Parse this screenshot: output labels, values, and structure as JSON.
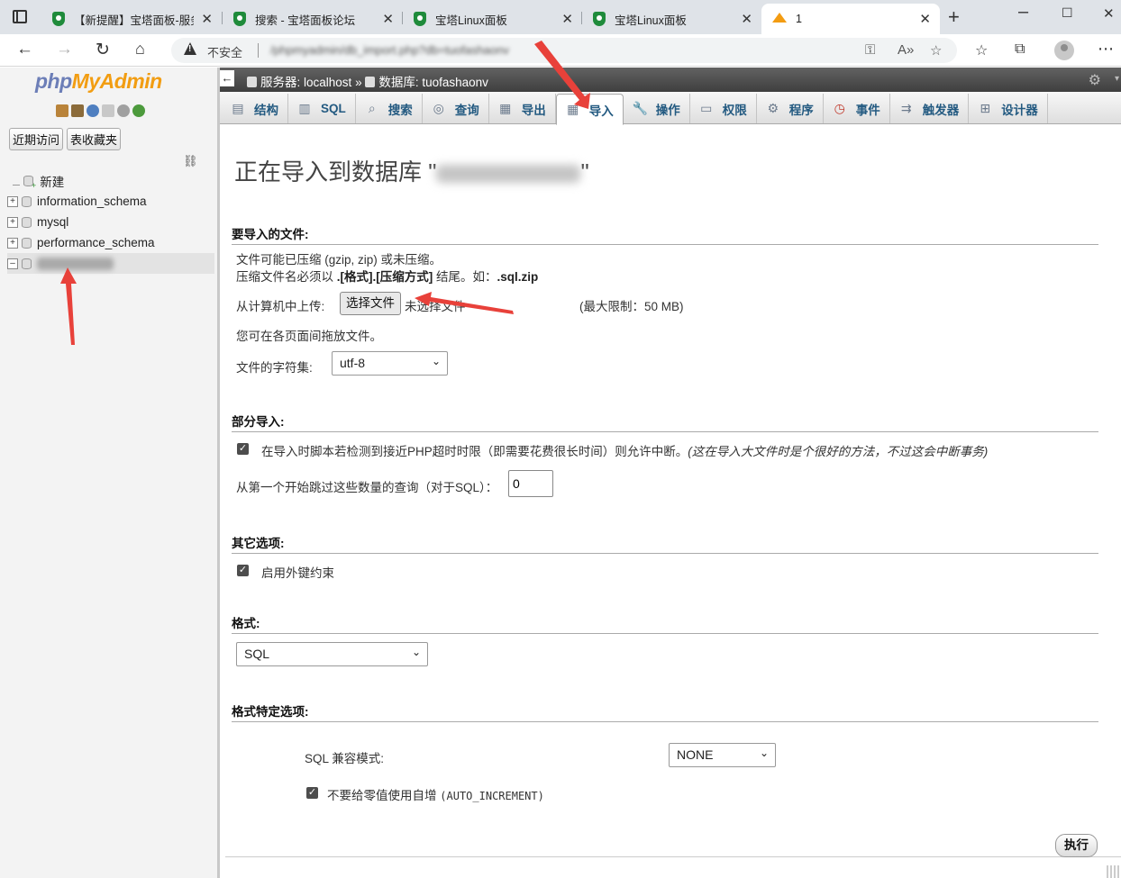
{
  "browser": {
    "tabs": [
      {
        "title": "【新提醒】宝塔面板-服务",
        "close": "✕"
      },
      {
        "title": "搜索 - 宝塔面板论坛",
        "close": "✕"
      },
      {
        "title": "宝塔Linux面板",
        "close": "✕"
      },
      {
        "title": "宝塔Linux面板",
        "close": "✕"
      },
      {
        "title": "1",
        "close": "✕"
      }
    ],
    "new_tab": "+",
    "address": {
      "security_label": "不安全",
      "url": "/phpmyadmin/db_import.php?db=tuofashaonv"
    }
  },
  "left": {
    "logo_php": "php",
    "logo_myadmin": "MyAdmin",
    "recent_btn": "近期访问",
    "favorites_btn": "表收藏夹",
    "tree": [
      {
        "label": "新建"
      },
      {
        "label": "information_schema"
      },
      {
        "label": "mysql"
      },
      {
        "label": "performance_schema"
      }
    ]
  },
  "breadcrumb": {
    "server": "服务器: localhost",
    "sep": "»",
    "database": "数据库: tuofashaonv"
  },
  "tabs": [
    {
      "label": "结构",
      "icon": "structure-icon"
    },
    {
      "label": "SQL",
      "icon": "sql-icon"
    },
    {
      "label": "搜索",
      "icon": "search-icon"
    },
    {
      "label": "查询",
      "icon": "query-icon"
    },
    {
      "label": "导出",
      "icon": "export-icon"
    },
    {
      "label": "导入",
      "icon": "import-icon"
    },
    {
      "label": "操作",
      "icon": "wrench-icon"
    },
    {
      "label": "权限",
      "icon": "privileges-icon"
    },
    {
      "label": "程序",
      "icon": "routines-icon"
    },
    {
      "label": "事件",
      "icon": "events-icon"
    },
    {
      "label": "触发器",
      "icon": "triggers-icon"
    },
    {
      "label": "设计器",
      "icon": "designer-icon"
    }
  ],
  "page": {
    "title_prefix": "正在导入到数据库 \"",
    "title_suffix": "\"",
    "file_section": {
      "heading": "要导入的文件:",
      "line1": "文件可能已压缩 (gzip, zip) 或未压缩。",
      "line2_prefix": "压缩文件名必须以 ",
      "line2_bold": ".[格式].[压缩方式]",
      "line2_mid": " 结尾。如：",
      "line2_example": ".sql.zip",
      "upload_label": "从计算机中上传:",
      "choose_file": "选择文件",
      "no_file": "未选择文件",
      "max_limit": "(最大限制：50 MB)",
      "drag_hint": "您可在各页面间拖放文件。",
      "charset_label": "文件的字符集:",
      "charset_value": "utf-8"
    },
    "partial_section": {
      "heading": "部分导入:",
      "interrupt_text": "在导入时脚本若检测到接近PHP超时时限（即需要花费很长时间）则允许中断。",
      "interrupt_hint": "(这在导入大文件时是个很好的方法，不过这会中断事务)",
      "skip_label": "从第一个开始跳过这些数量的查询（对于SQL）：",
      "skip_value": "0"
    },
    "other_section": {
      "heading": "其它选项:",
      "fk_label": "启用外键约束"
    },
    "format_section": {
      "heading": "格式:",
      "format_value": "SQL"
    },
    "format_options": {
      "heading": "格式特定选项:",
      "compat_label": "SQL 兼容模式:",
      "compat_value": "NONE",
      "auto_inc_label": "不要给零值使用自增",
      "auto_inc_code": "(AUTO_INCREMENT)"
    },
    "go_button": "执行"
  },
  "colors": {
    "tab_text": "#235a81",
    "breadcrumb_bg": "#4f4f4f",
    "annotation_arrow": "#e8413a"
  }
}
